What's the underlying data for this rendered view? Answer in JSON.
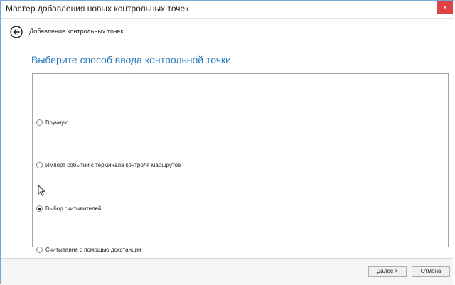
{
  "window": {
    "title": "Мастер добавления новых контрольных точек",
    "close_glyph": "×"
  },
  "nav": {
    "back_icon": "back-arrow-icon",
    "title": "Добавление контрольных точек"
  },
  "main": {
    "heading": "Выберите способ ввода контрольной точки",
    "options": [
      {
        "label": "Вручную",
        "checked": false
      },
      {
        "label": "Импорт событий с терминала контроля маршрутов",
        "checked": false
      },
      {
        "label": "Выбор считывателей",
        "checked": true
      },
      {
        "label": "Считывание с помощью докстанции",
        "checked": false
      }
    ]
  },
  "footer": {
    "next_label": "Далее >",
    "cancel_label": "Отмена"
  },
  "colors": {
    "accent": "#2a7bc1",
    "close": "#e04343"
  }
}
